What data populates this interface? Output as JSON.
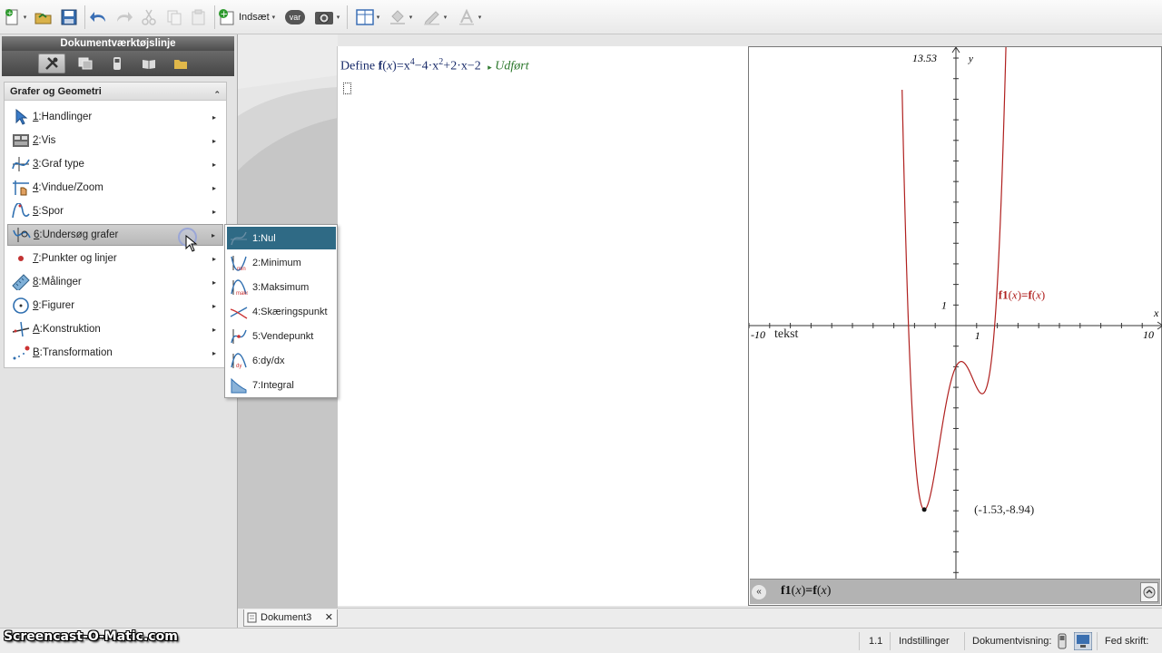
{
  "toolbar": {
    "insert_label": "Indsæt",
    "var_label": "var"
  },
  "left_panel": {
    "title": "Dokumentværktøjslinje",
    "section_title": "Grafer og Geometri",
    "menu": [
      {
        "key": "1",
        "label": ":Handlinger",
        "icon": "pointer-arrow-icon"
      },
      {
        "key": "2",
        "label": ":Vis",
        "icon": "view-icon"
      },
      {
        "key": "3",
        "label": ":Graf type",
        "icon": "graph-type-icon"
      },
      {
        "key": "4",
        "label": ":Vindue/Zoom",
        "icon": "window-zoom-icon"
      },
      {
        "key": "5",
        "label": ":Spor",
        "icon": "trace-icon"
      },
      {
        "key": "6",
        "label": ":Undersøg grafer",
        "icon": "analyze-graph-icon"
      },
      {
        "key": "7",
        "label": ":Punkter og linjer",
        "icon": "point-icon"
      },
      {
        "key": "8",
        "label": ":Målinger",
        "icon": "ruler-icon"
      },
      {
        "key": "9",
        "label": ":Figurer",
        "icon": "circle-icon"
      },
      {
        "key": "A",
        "label": ":Konstruktion",
        "icon": "construction-icon"
      },
      {
        "key": "B",
        "label": ":Transformation",
        "icon": "transformation-icon"
      }
    ]
  },
  "submenu": {
    "items": [
      {
        "label": "1:Nul",
        "icon": "zero-icon"
      },
      {
        "label": "2:Minimum",
        "icon": "minimum-icon"
      },
      {
        "label": "3:Maksimum",
        "icon": "maximum-icon"
      },
      {
        "label": "4:Skæringspunkt",
        "icon": "intersection-icon"
      },
      {
        "label": "5:Vendepunkt",
        "icon": "inflection-icon"
      },
      {
        "label": "6:dy/dx",
        "icon": "derivative-icon"
      },
      {
        "label": "7:Integral",
        "icon": "integral-icon"
      }
    ]
  },
  "calculator": {
    "define_word": "Define",
    "fname": "f",
    "var": "x",
    "expr_a": "=x",
    "exp4": "4",
    "expr_b": "−4·x",
    "exp2": "2",
    "expr_c": "+2·x−2",
    "result_marker": "▸",
    "result": "Udført"
  },
  "graph": {
    "y_max_label": "13.53",
    "y_axis_label": "y",
    "x_axis_label": "x",
    "x_min_label": "-10",
    "x_max_label": "10",
    "x_unit_label": "1",
    "y_unit_label": "1",
    "text_label": "tekst",
    "function_label_name": "f1",
    "function_label_rhs": "=f",
    "point_label": "(-1.53,-8.94)",
    "entry_name": "f1",
    "entry_rhs": "=f",
    "curve_color": "#b0201f",
    "chart_data": {
      "type": "line",
      "series": [
        {
          "name": "f1(x)=f(x)",
          "function": "x^4-4x^2+2x-2"
        }
      ],
      "xlim": [
        -10,
        10
      ],
      "ylim": [
        -13.53,
        13.53
      ],
      "marked_point": [
        -1.53,
        -8.94
      ]
    }
  },
  "tabs": {
    "doc_tab": "Dokument3",
    "close": "✕"
  },
  "status": {
    "page": "1.1",
    "settings": "Indstillinger",
    "doc_view": "Dokumentvisning:",
    "bold_font": "Fed skrift:"
  },
  "watermark": "Screencast-O-Matic.com"
}
